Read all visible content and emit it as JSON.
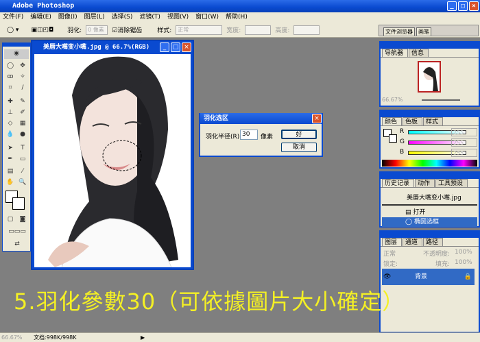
{
  "app": {
    "title": "Adobe Photoshop"
  },
  "menu": [
    "文件(F)",
    "编辑(E)",
    "图像(I)",
    "图层(L)",
    "选择(S)",
    "滤镜(T)",
    "视图(V)",
    "窗口(W)",
    "帮助(H)"
  ],
  "options": {
    "feather_label": "羽化:",
    "feather_value": "0 像素",
    "antialias_label": "消除锯齿",
    "style_label": "样式:",
    "style_value": "正常",
    "width_label": "宽度:",
    "height_label": "高度:",
    "well_tabs": [
      "文件浏览器",
      "画笔"
    ]
  },
  "document": {
    "title": "美唇大嘴变小嘴.jpg @ 66.7%(RGB)"
  },
  "dialog": {
    "title": "羽化选区",
    "radius_label": "羽化半径(R):",
    "radius_value": "30",
    "unit": "像素",
    "ok": "好",
    "cancel": "取消"
  },
  "navigator": {
    "tabs": [
      "导航器",
      "信息"
    ],
    "zoom": "66.67%"
  },
  "color": {
    "tabs": [
      "颜色",
      "色板",
      "样式"
    ],
    "channels": [
      {
        "name": "R",
        "value": "255"
      },
      {
        "name": "G",
        "value": "255"
      },
      {
        "name": "B",
        "value": "255"
      }
    ]
  },
  "history": {
    "tabs": [
      "历史记录",
      "动作",
      "工具预设"
    ],
    "snapshot": "美唇大嘴变小嘴.jpg",
    "items": [
      "打开",
      "椭圆选框"
    ]
  },
  "layers": {
    "tabs": [
      "图层",
      "通道",
      "路径"
    ],
    "blend": "正常",
    "opacity_label": "不透明度:",
    "opacity": "100%",
    "lock_label": "锁定:",
    "fill_label": "填充:",
    "fill": "100%",
    "layer_name": "背景"
  },
  "caption": "5.羽化參數30（可依據圖片大小確定）",
  "status": {
    "zoom": "66.67%",
    "doc": "文档:998K/998K"
  }
}
